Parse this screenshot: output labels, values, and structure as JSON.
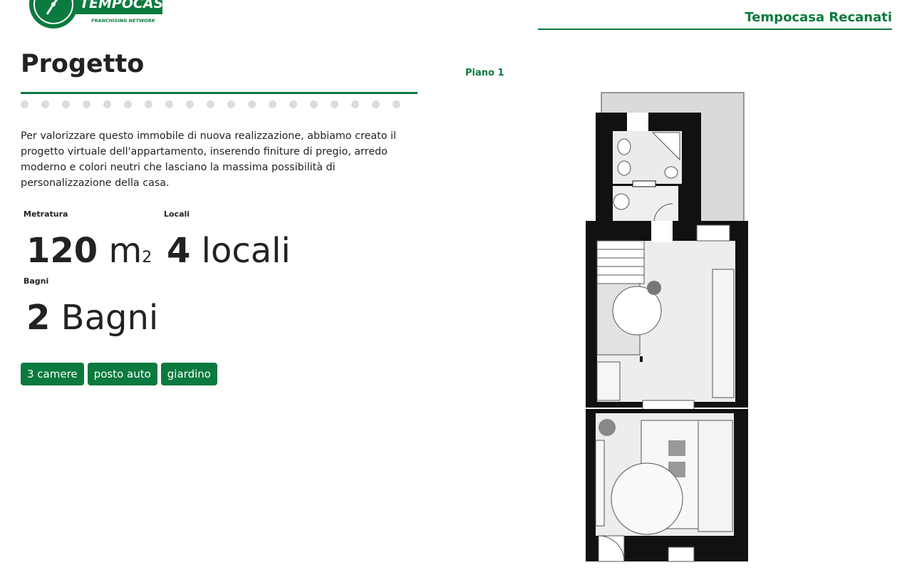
{
  "header": {
    "logo_text": "TEMPOCASA",
    "logo_subtext": "FRANCHISING NETWORK",
    "agency_name": "Tempocasa Recanati",
    "brand_color": "#0a7a3e"
  },
  "main": {
    "title": "Progetto",
    "gallery_dots_count": 19,
    "description": "Per valorizzare questo immobile di nuova realizzazione, abbiamo creato il progetto virtuale dell'appartamento, inserendo finiture di pregio, arredo moderno e colori neutri che lasciano la massima possibilità di personalizzazione della casa.",
    "stats": {
      "metratura": {
        "label": "Metratura",
        "value": "120",
        "unit": "m",
        "sup": "2"
      },
      "locali": {
        "label": "Locali",
        "value": "4",
        "unit": "locali"
      },
      "bagni": {
        "label": "Bagni",
        "value": "2",
        "unit": "Bagni"
      }
    },
    "tags": [
      "3 camere",
      "posto auto",
      "giardino"
    ]
  },
  "floorplan": {
    "label": "Piano 1",
    "icon": "floor-plan-drawing"
  }
}
